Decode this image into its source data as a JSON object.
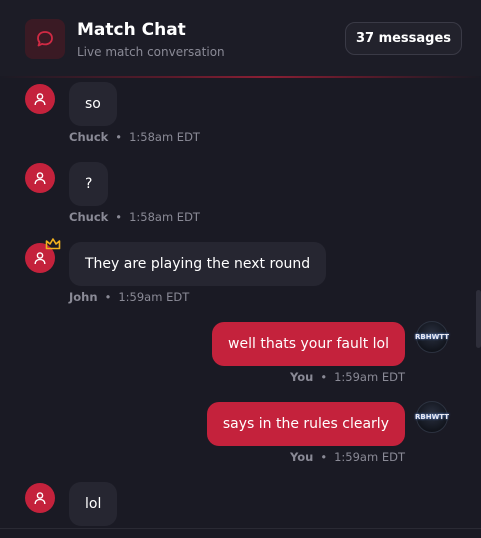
{
  "header": {
    "title": "Match Chat",
    "subtitle": "Live match conversation",
    "message_count": "37 messages",
    "logo_icon": "chat-bubble-icon"
  },
  "colors": {
    "accent": "#c4223c",
    "background": "#1a1a24",
    "bubble_incoming": "#262631",
    "muted_text": "#8a8a96"
  },
  "messages": [
    {
      "author": "Chuck",
      "text": "so",
      "time": "1:58am EDT",
      "outgoing": false
    },
    {
      "author": "Chuck",
      "text": "?",
      "time": "1:58am EDT",
      "outgoing": false
    },
    {
      "author": "John",
      "text": "They are playing the next round",
      "time": "1:59am EDT",
      "outgoing": false,
      "badge": "crown-icon"
    },
    {
      "author": "You",
      "text": "well thats your fault lol",
      "time": "1:59am EDT",
      "outgoing": true,
      "avatar_text": "RBHWTT"
    },
    {
      "author": "You",
      "text": "says in the rules clearly",
      "time": "1:59am EDT",
      "outgoing": true,
      "avatar_text": "RBHWTT"
    },
    {
      "author": "",
      "text": "lol",
      "time": "",
      "outgoing": false
    }
  ],
  "dot": "•"
}
